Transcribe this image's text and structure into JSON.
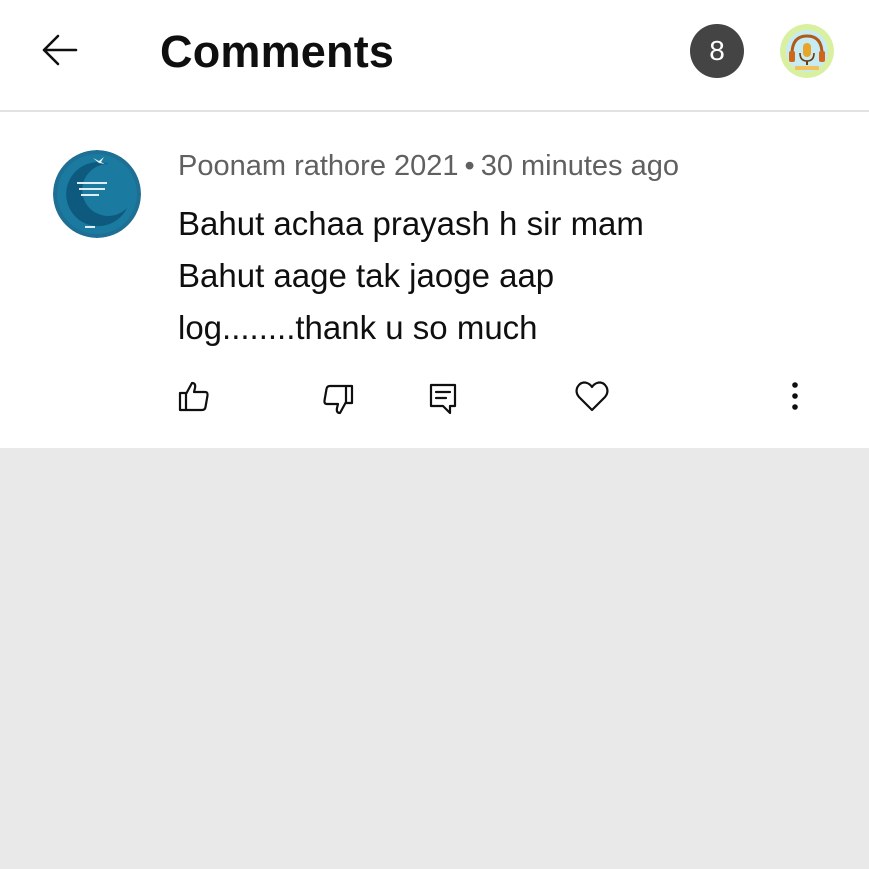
{
  "header": {
    "title": "Comments",
    "comment_count": "8",
    "back_icon": "arrow-left-icon",
    "avatar_icon": "headphones-mic-logo-icon"
  },
  "comment": {
    "author": "Poonam rathore 2021",
    "separator": "•",
    "time": "30 minutes ago",
    "lines": [
      "Bahut achaa prayash h sir mam",
      "Bahut aage tak jaoge aap",
      "log........thank u so much"
    ],
    "avatar_icon": "moon-bird-avatar-icon",
    "actions": [
      "thumbs-up-icon",
      "thumbs-down-icon",
      "reply-icon",
      "heart-icon",
      "more-vert-icon"
    ]
  },
  "colors": {
    "header_bg": "#ffffff",
    "page_bg": "#e9e9e9",
    "badge_bg": "#444444",
    "meta_text": "#606060",
    "body_text": "#0f0f0f"
  }
}
